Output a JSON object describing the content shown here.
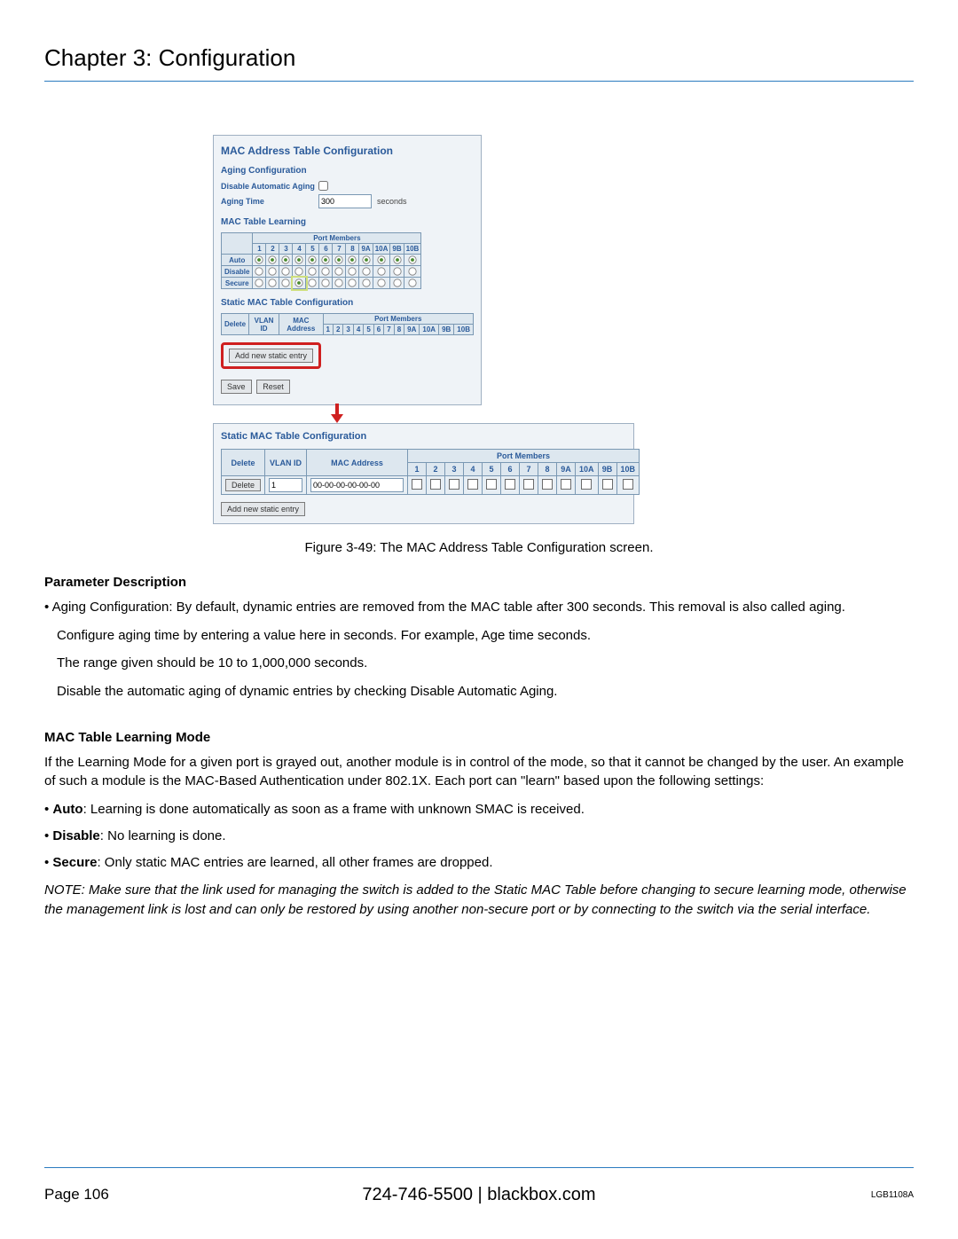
{
  "chapter": "Chapter 3: Configuration",
  "panel1": {
    "title": "MAC Address Table Configuration",
    "aging_sect": "Aging Configuration",
    "disable_lbl": "Disable Automatic Aging",
    "aging_time_lbl": "Aging Time",
    "aging_time_val": "300",
    "seconds": "seconds",
    "learning_sect": "MAC Table Learning",
    "port_members": "Port Members",
    "ports": [
      "1",
      "2",
      "3",
      "4",
      "5",
      "6",
      "7",
      "8",
      "9A",
      "10A",
      "9B",
      "10B"
    ],
    "rows": [
      "Auto",
      "Disable",
      "Secure"
    ],
    "static_sect": "Static MAC Table Configuration",
    "static_cols": [
      "Delete",
      "VLAN ID",
      "MAC Address"
    ],
    "static_ports": [
      "1",
      "2",
      "3",
      "4",
      "5",
      "6",
      "7",
      "8",
      "9A",
      "10A",
      "9B",
      "10B"
    ],
    "add_btn": "Add new static entry",
    "save": "Save",
    "reset": "Reset"
  },
  "panel2": {
    "title": "Static MAC Table Configuration",
    "port_members": "Port Members",
    "cols": {
      "delete": "Delete",
      "vlan": "VLAN ID",
      "mac": "MAC Address"
    },
    "ports": [
      "1",
      "2",
      "3",
      "4",
      "5",
      "6",
      "7",
      "8",
      "9A",
      "10A",
      "9B",
      "10B"
    ],
    "row": {
      "delete_btn": "Delete",
      "vlan": "1",
      "mac": "00-00-00-00-00-00"
    },
    "add_btn": "Add new static entry"
  },
  "caption": "Figure 3-49: The MAC Address Table Configuration screen.",
  "param_title": "Parameter Description",
  "bullet1": "• Aging Configuration: By default, dynamic entries are removed from the MAC table after 300 seconds. This removal is also called aging.",
  "para1": "Configure aging time by entering a value here in seconds. For example, Age time seconds.",
  "para2": "The range given should be 10 to 1,000,000 seconds.",
  "para3": "Disable the automatic aging of dynamic entries by checking Disable Automatic Aging.",
  "learning_title": "MAC Table Learning Mode",
  "learning_intro": "If the Learning Mode for a given port is grayed out, another module is in control of the mode, so that it cannot be changed by the user. An example of such a module is the MAC-Based Authentication under 802.1X. Each port can \"learn\" based upon the following settings:",
  "auto_b": "Auto",
  "auto_t": ": Learning is done automatically as soon as a frame with unknown SMAC is received.",
  "dis_b": "Disable",
  "dis_t": ": No learning is done.",
  "sec_b": "Secure",
  "sec_t": ": Only static MAC entries are learned, all other frames are dropped.",
  "note": "NOTE: Make sure that the link used for managing the switch is added to the Static MAC Table before changing to secure learning mode, otherwise the management link is lost and can only be restored by using another non-secure port or by connecting to the switch via the serial interface.",
  "footer": {
    "page": "Page 106",
    "center": "724-746-5500    |    blackbox.com",
    "model": "LGB1108A"
  }
}
